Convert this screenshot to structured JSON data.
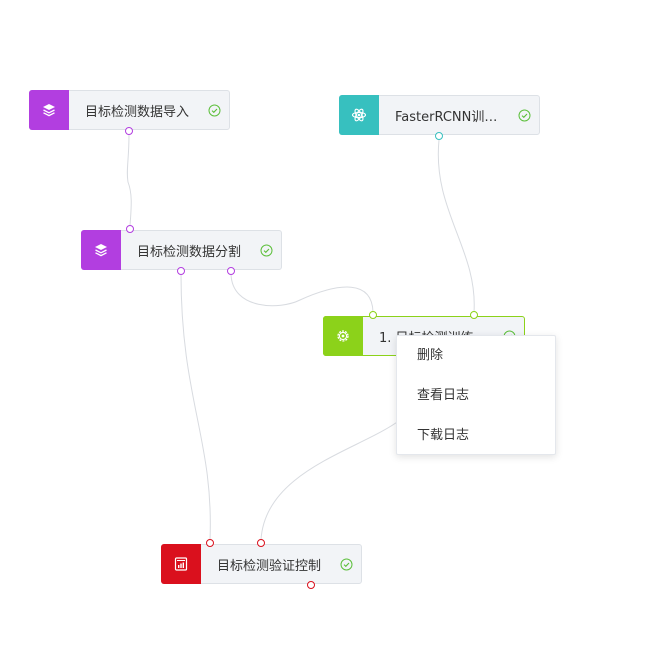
{
  "colors": {
    "purple": "#b23ee0",
    "teal": "#37c0bf",
    "green": "#8cd21a",
    "red": "#da101d",
    "status_green": "#5cbf3b",
    "edge": "#d8dbe0"
  },
  "nodes": {
    "import": {
      "label": "目标检测数据导入",
      "icon": "layers-icon"
    },
    "model": {
      "label": "FasterRCNN训…",
      "icon": "atom-icon"
    },
    "split": {
      "label": "目标检测数据分割",
      "icon": "layers-icon"
    },
    "train": {
      "label": "1. 目标检测训练",
      "icon": "gear-icon"
    },
    "validate": {
      "label": "目标检测验证控制",
      "icon": "report-icon"
    }
  },
  "context_menu": {
    "items": [
      {
        "label": "删除"
      },
      {
        "label": "查看日志"
      },
      {
        "label": "下载日志"
      }
    ]
  }
}
